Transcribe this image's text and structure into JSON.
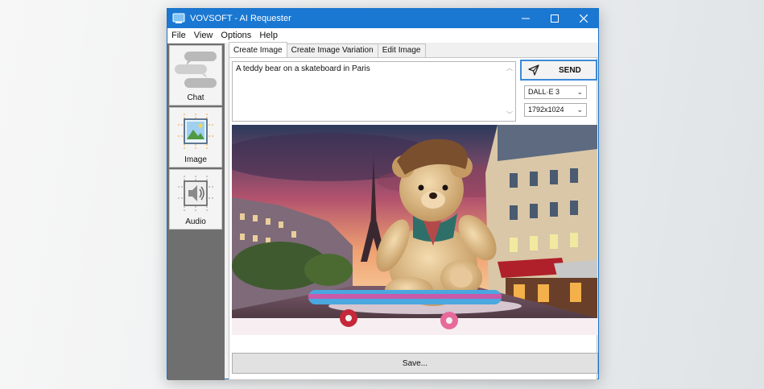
{
  "window": {
    "title": "VOVSOFT - AI Requester",
    "controls": [
      "minimize-icon",
      "maximize-icon",
      "close-icon"
    ]
  },
  "menu": {
    "items": [
      "File",
      "View",
      "Options",
      "Help"
    ]
  },
  "sidebar": {
    "items": [
      {
        "label": "Chat",
        "icon": "chat-bubbles-icon"
      },
      {
        "label": "Image",
        "icon": "image-icon",
        "selected": true
      },
      {
        "label": "Audio",
        "icon": "speaker-icon"
      }
    ]
  },
  "tabs": {
    "items": [
      "Create Image",
      "Create Image Variation",
      "Edit Image"
    ],
    "active": "Create Image"
  },
  "prompt": {
    "value": "A teddy bear on a skateboard in Paris"
  },
  "send": {
    "label": "SEND",
    "icon": "send-arrow-icon"
  },
  "model": {
    "selected": "DALL·E 3"
  },
  "size": {
    "selected": "1792x1024"
  },
  "save": {
    "label": "Save..."
  },
  "colors": {
    "titlebar": "#1a78d2",
    "sidebar": "#6f6f6f",
    "accent": "#3c8ad6"
  }
}
